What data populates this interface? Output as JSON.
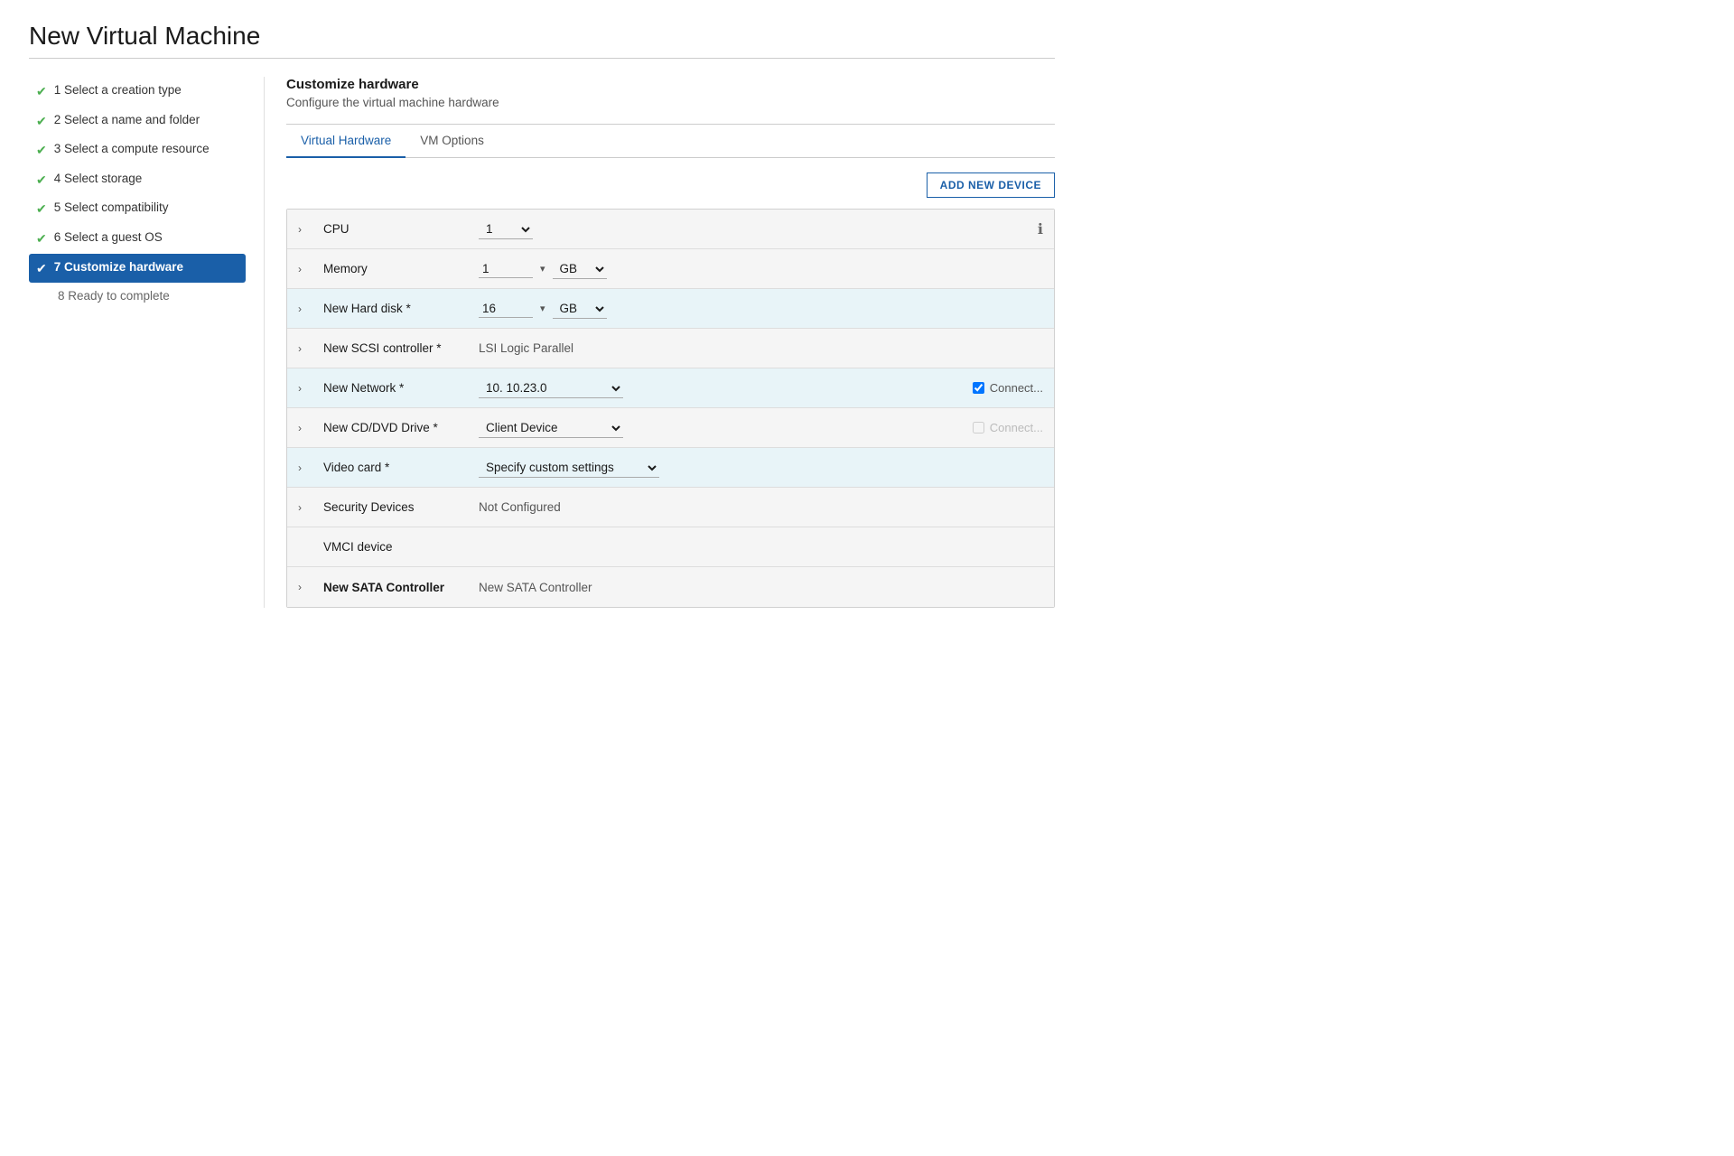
{
  "page": {
    "title": "New Virtual Machine"
  },
  "sidebar": {
    "items": [
      {
        "id": "step1",
        "number": "1",
        "label": "Select a creation type",
        "state": "completed"
      },
      {
        "id": "step2",
        "number": "2",
        "label": "Select a name and folder",
        "state": "completed"
      },
      {
        "id": "step3",
        "number": "3",
        "label": "Select a compute resource",
        "state": "completed"
      },
      {
        "id": "step4",
        "number": "4",
        "label": "Select storage",
        "state": "completed"
      },
      {
        "id": "step5",
        "number": "5",
        "label": "Select compatibility",
        "state": "completed"
      },
      {
        "id": "step6",
        "number": "6",
        "label": "Select a guest OS",
        "state": "completed"
      },
      {
        "id": "step7",
        "number": "7",
        "label": "Customize hardware",
        "state": "active"
      },
      {
        "id": "step8",
        "number": "8",
        "label": "Ready to complete",
        "state": "inactive"
      }
    ]
  },
  "content": {
    "header": {
      "title": "Customize hardware",
      "subtitle": "Configure the virtual machine hardware"
    },
    "tabs": [
      {
        "id": "virtual-hardware",
        "label": "Virtual Hardware",
        "active": true
      },
      {
        "id": "vm-options",
        "label": "VM Options",
        "active": false
      }
    ],
    "toolbar": {
      "add_device_label": "ADD NEW DEVICE"
    },
    "hardware_rows": [
      {
        "id": "cpu-row",
        "type": "control",
        "label": "CPU",
        "highlighted": false,
        "value": "1",
        "control_type": "select",
        "show_info": true
      },
      {
        "id": "memory-row",
        "type": "control",
        "label": "Memory",
        "highlighted": false,
        "value": "1",
        "unit": "GB",
        "control_type": "input_unit_select"
      },
      {
        "id": "hard-disk-row",
        "type": "control",
        "label": "New Hard disk *",
        "highlighted": true,
        "value": "16",
        "unit": "GB",
        "control_type": "input_unit_select"
      },
      {
        "id": "scsi-row",
        "type": "text",
        "label": "New SCSI controller *",
        "highlighted": false,
        "value": "LSI Logic Parallel"
      },
      {
        "id": "network-row",
        "type": "select_connect",
        "label": "New Network *",
        "highlighted": true,
        "value": "10. 10.23.0",
        "connect_checked": true,
        "connect_label": "Connect...",
        "connect_disabled": false
      },
      {
        "id": "cddvd-row",
        "type": "select_connect",
        "label": "New CD/DVD Drive *",
        "highlighted": false,
        "value": "Client Device",
        "connect_checked": false,
        "connect_label": "Connect...",
        "connect_disabled": true
      },
      {
        "id": "video-row",
        "type": "select_only",
        "label": "Video card *",
        "highlighted": true,
        "value": "Specify custom settings"
      },
      {
        "id": "security-row",
        "type": "text",
        "label": "Security Devices",
        "highlighted": false,
        "value": "Not Configured"
      },
      {
        "id": "vmci-row",
        "type": "plain_label",
        "label": "VMCI device",
        "highlighted": false,
        "value": ""
      },
      {
        "id": "sata-row",
        "type": "text",
        "label": "New SATA Controller",
        "highlighted": false,
        "value": "New SATA Controller",
        "bold_label": true
      }
    ]
  }
}
